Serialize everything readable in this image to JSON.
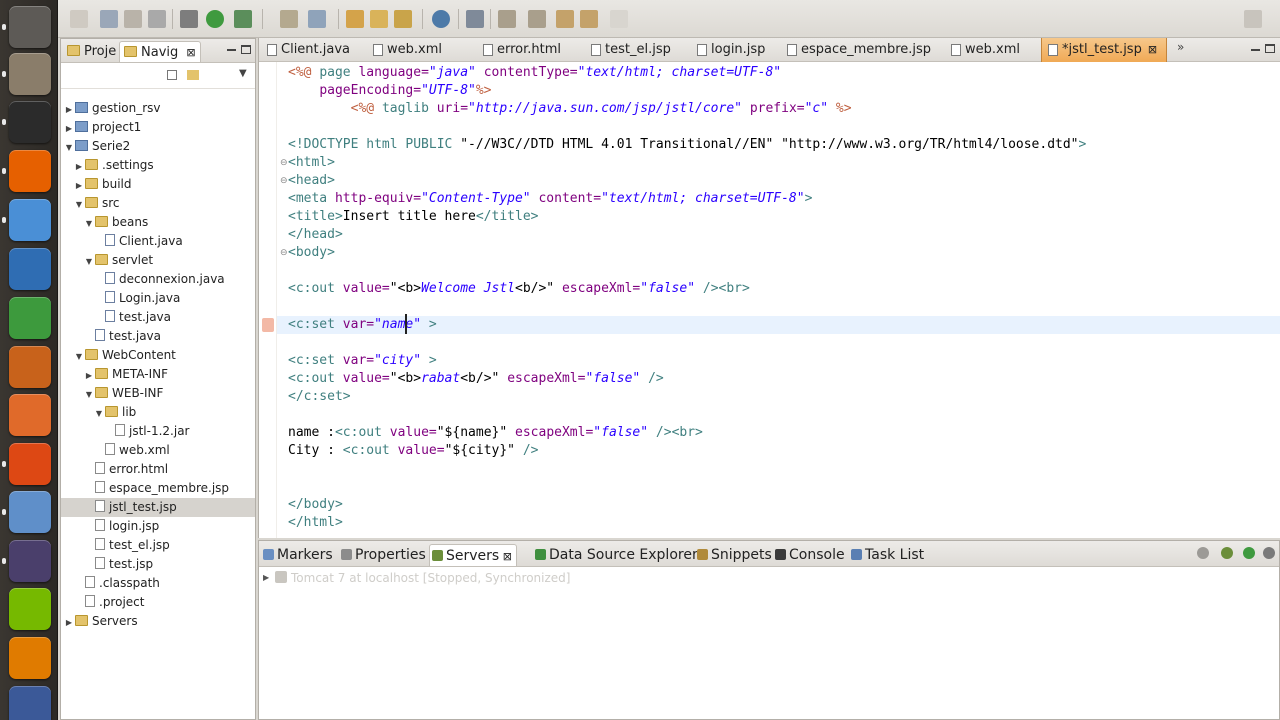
{
  "navigator": {
    "tabs": [
      {
        "label": "Proje"
      },
      {
        "label": "Navig",
        "close": "⊠"
      }
    ],
    "tree": [
      {
        "label": "gestion_rsv",
        "arrow": "▶",
        "kind": "proj",
        "level": 0
      },
      {
        "label": "project1",
        "arrow": "▶",
        "kind": "proj",
        "level": 0
      },
      {
        "label": "Serie2",
        "arrow": "▼",
        "kind": "proj",
        "level": 0
      },
      {
        "label": ".settings",
        "arrow": "▶",
        "kind": "folder",
        "level": 1
      },
      {
        "label": "build",
        "arrow": "▶",
        "kind": "folder",
        "level": 1
      },
      {
        "label": "src",
        "arrow": "▼",
        "kind": "folder",
        "level": 1
      },
      {
        "label": "beans",
        "arrow": "▼",
        "kind": "folder",
        "level": 2
      },
      {
        "label": "Client.java",
        "arrow": "",
        "kind": "jfile",
        "level": 3
      },
      {
        "label": "servlet",
        "arrow": "▼",
        "kind": "folder",
        "level": 2
      },
      {
        "label": "deconnexion.java",
        "arrow": "",
        "kind": "jfile",
        "level": 3
      },
      {
        "label": "Login.java",
        "arrow": "",
        "kind": "jfile",
        "level": 3
      },
      {
        "label": "test.java",
        "arrow": "",
        "kind": "jfile",
        "level": 3
      },
      {
        "label": "test.java",
        "arrow": "",
        "kind": "jfile",
        "level": 2
      },
      {
        "label": "WebContent",
        "arrow": "▼",
        "kind": "folder",
        "level": 1
      },
      {
        "label": "META-INF",
        "arrow": "▶",
        "kind": "folder",
        "level": 2
      },
      {
        "label": "WEB-INF",
        "arrow": "▼",
        "kind": "folder",
        "level": 2
      },
      {
        "label": "lib",
        "arrow": "▼",
        "kind": "folder",
        "level": 3
      },
      {
        "label": "jstl-1.2.jar",
        "arrow": "",
        "kind": "file",
        "level": 4
      },
      {
        "label": "web.xml",
        "arrow": "",
        "kind": "file",
        "level": 3
      },
      {
        "label": "error.html",
        "arrow": "",
        "kind": "file",
        "level": 2
      },
      {
        "label": "espace_membre.jsp",
        "arrow": "",
        "kind": "file",
        "level": 2
      },
      {
        "label": "jstl_test.jsp",
        "arrow": "",
        "kind": "file",
        "level": 2,
        "selected": true
      },
      {
        "label": "login.jsp",
        "arrow": "",
        "kind": "file",
        "level": 2
      },
      {
        "label": "test_el.jsp",
        "arrow": "",
        "kind": "file",
        "level": 2
      },
      {
        "label": "test.jsp",
        "arrow": "",
        "kind": "file",
        "level": 2
      },
      {
        "label": ".classpath",
        "arrow": "",
        "kind": "file",
        "level": 1
      },
      {
        "label": ".project",
        "arrow": "",
        "kind": "file",
        "level": 1
      },
      {
        "label": "Servers",
        "arrow": "▶",
        "kind": "folder",
        "level": 0
      }
    ]
  },
  "editor": {
    "tabs": [
      {
        "label": "Client.java"
      },
      {
        "label": "web.xml"
      },
      {
        "label": "error.html"
      },
      {
        "label": "test_el.jsp"
      },
      {
        "label": "login.jsp"
      },
      {
        "label": "espace_membre.jsp"
      },
      {
        "label": "web.xml"
      },
      {
        "label": "*jstl_test.jsp",
        "active": true,
        "close": "⊠"
      }
    ],
    "overflow": "»",
    "lines": [
      "<span class=\"dir\">&lt;%@</span> <span class=\"kw\">page</span> <span class=\"at\">language=</span><span class=\"val\">\"java\"</span> <span class=\"at\">contentType=</span><span class=\"val\">\"text/html; charset=UTF-8\"</span>",
      "    <span class=\"at\">pageEncoding=</span><span class=\"val\">\"UTF-8\"</span><span class=\"dir\">%&gt;</span>",
      "        <span class=\"dir\">&lt;%@</span> <span class=\"kw\">taglib</span> <span class=\"at\">uri=</span><span class=\"val\">\"http://java.sun.com/jsp/jstl/core\"</span> <span class=\"at\">prefix=</span><span class=\"val\">\"c\"</span> <span class=\"dir\">%&gt;</span>",
      "",
      "<span class=\"kw\">&lt;!DOCTYPE html PUBLIC</span> <span class=\"txt\">\"-//W3C//DTD HTML 4.01 Transitional//EN\" \"http://www.w3.org/TR/html4/loose.dtd\"</span><span class=\"kw\">&gt;</span>",
      "<span class=\"kw\">&lt;html&gt;</span>",
      "<span class=\"kw\">&lt;head&gt;</span>",
      "<span class=\"kw\">&lt;meta</span> <span class=\"at\">http-equiv=</span><span class=\"val\">\"Content-Type\"</span> <span class=\"at\">content=</span><span class=\"val\">\"text/html; charset=UTF-8\"</span><span class=\"kw\">&gt;</span>",
      "<span class=\"kw\">&lt;title&gt;</span><span class=\"txt\">Insert title here</span><span class=\"kw\">&lt;/title&gt;</span>",
      "<span class=\"kw\">&lt;/head&gt;</span>",
      "<span class=\"kw\">&lt;body&gt;</span>",
      "",
      "<span class=\"kw\">&lt;c:out</span> <span class=\"at\">value=</span><span class=\"txt\">\"&lt;b&gt;</span><span class=\"val\">Welcome Jstl</span><span class=\"txt\">&lt;b/&gt;\"</span> <span class=\"at\">escapeXml=</span><span class=\"val\">\"false\"</span> <span class=\"kw\">/&gt;&lt;br&gt;</span>",
      "",
      "<span class=\"kw\">&lt;c:set</span> <span class=\"at\">var=</span><span class=\"val\">\"name\"</span> <span class=\"kw\">&gt;</span>",
      "",
      "<span class=\"kw\">&lt;c:set</span> <span class=\"at\">var=</span><span class=\"val\">\"city\"</span> <span class=\"kw\">&gt;</span>",
      "<span class=\"kw\">&lt;c:out</span> <span class=\"at\">value=</span><span class=\"txt\">\"&lt;b&gt;</span><span class=\"val\">rabat</span><span class=\"txt\">&lt;b/&gt;\"</span> <span class=\"at\">escapeXml=</span><span class=\"val\">\"false\"</span> <span class=\"kw\">/&gt;</span>",
      "<span class=\"kw\">&lt;/c:set&gt;</span>",
      "",
      "<span class=\"txt\">name :</span><span class=\"kw\">&lt;c:out</span> <span class=\"at\">value=</span><span class=\"txt\">\"${name}\"</span> <span class=\"at\">escapeXml=</span><span class=\"val\">\"false\"</span> <span class=\"kw\">/&gt;&lt;br&gt;</span>",
      "<span class=\"txt\">City :</span> <span class=\"kw\">&lt;c:out</span> <span class=\"at\">value=</span><span class=\"txt\">\"${city}\"</span> <span class=\"kw\">/&gt;</span>",
      "",
      "",
      "<span class=\"kw\">&lt;/body&gt;</span>",
      "<span class=\"kw\">&lt;/html&gt;</span>"
    ]
  },
  "bottom": {
    "tabs": [
      {
        "label": "Markers",
        "color": "#6a8fc2"
      },
      {
        "label": "Properties",
        "color": "#8c8c8c"
      },
      {
        "label": "Servers",
        "color": "#6b8e3a",
        "active": true,
        "close": "⊠"
      },
      {
        "label": "Data Source Explorer",
        "color": "#3f8f3f"
      },
      {
        "label": "Snippets",
        "color": "#b08a3a"
      },
      {
        "label": "Console",
        "color": "#3b3b3b"
      },
      {
        "label": "Task List",
        "color": "#5a7fb3"
      }
    ],
    "server_row": "Tomcat 7 at localhost  [Stopped, Synchronized]"
  },
  "colors": {
    "active_tab": "#f0a955",
    "current_line": "#e8f2fe",
    "keyword": "#3f7f7f",
    "attribute": "#7f007f",
    "string": "#2a00ff"
  },
  "launcher": [
    {
      "name": "dash-icon",
      "color": "#5d5a56"
    },
    {
      "name": "files-icon",
      "color": "#8a7d6a"
    },
    {
      "name": "terminal-icon",
      "color": "#2b2b2b"
    },
    {
      "name": "firefox-icon",
      "color": "#e66000"
    },
    {
      "name": "chrome-icon",
      "color": "#4a8fd6"
    },
    {
      "name": "writer-icon",
      "color": "#2f6db3"
    },
    {
      "name": "calc-icon",
      "color": "#3d9a3d"
    },
    {
      "name": "impress-icon",
      "color": "#c8621b"
    },
    {
      "name": "software-center-icon",
      "color": "#e06a2a"
    },
    {
      "name": "ubuntu-one-icon",
      "color": "#dd4814"
    },
    {
      "name": "virtualbox-icon",
      "color": "#5f8fc9"
    },
    {
      "name": "eclipse-icon",
      "color": "#4a3f6b"
    },
    {
      "name": "nvidia-icon",
      "color": "#76b900"
    },
    {
      "name": "vlc-icon",
      "color": "#e07b00"
    },
    {
      "name": "facebook-icon",
      "color": "#3b5998"
    }
  ]
}
